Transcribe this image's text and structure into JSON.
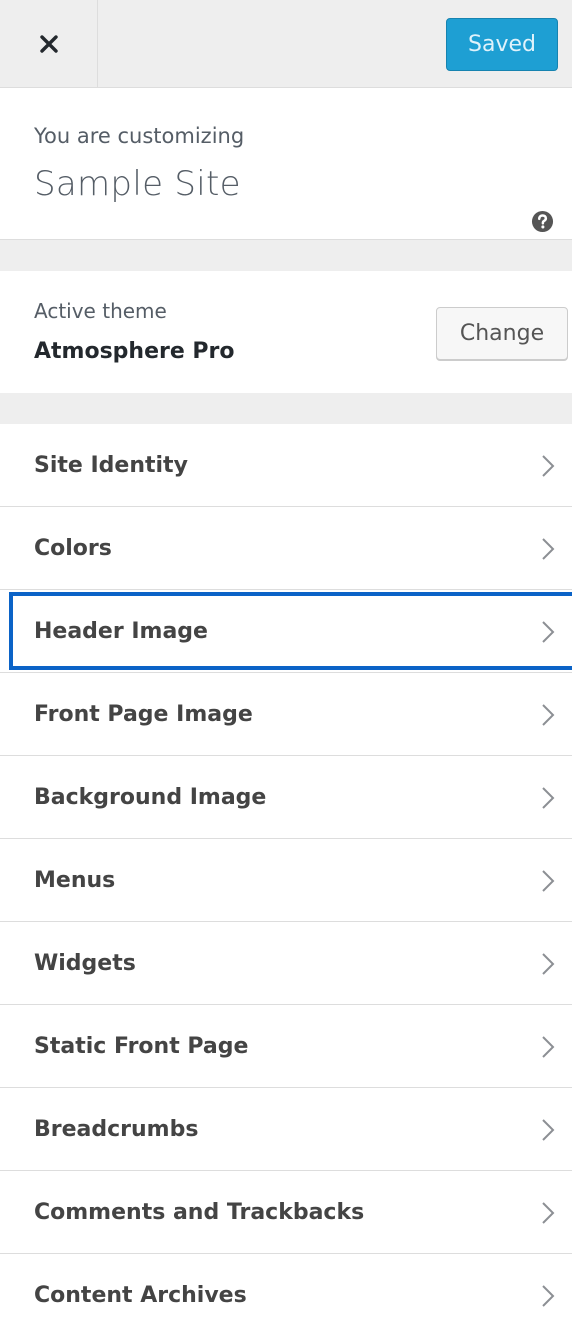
{
  "header": {
    "close_icon": "close-icon",
    "save_label": "Saved",
    "save_color": "#1e9fd3"
  },
  "info": {
    "label": "You are customizing",
    "site_title": "Sample Site",
    "help_icon": "help-icon"
  },
  "theme": {
    "label": "Active theme",
    "name": "Atmosphere Pro",
    "change_label": "Change"
  },
  "sections": [
    {
      "label": "Site Identity",
      "focused": false
    },
    {
      "label": "Colors",
      "focused": false
    },
    {
      "label": "Header Image",
      "focused": true
    },
    {
      "label": "Front Page Image",
      "focused": false
    },
    {
      "label": "Background Image",
      "focused": false
    },
    {
      "label": "Menus",
      "focused": false
    },
    {
      "label": "Widgets",
      "focused": false
    },
    {
      "label": "Static Front Page",
      "focused": false
    },
    {
      "label": "Breadcrumbs",
      "focused": false
    },
    {
      "label": "Comments and Trackbacks",
      "focused": false
    },
    {
      "label": "Content Archives",
      "focused": false
    }
  ],
  "colors": {
    "focus_ring": "#0b63c7",
    "panel_bg": "#eeeeee"
  }
}
